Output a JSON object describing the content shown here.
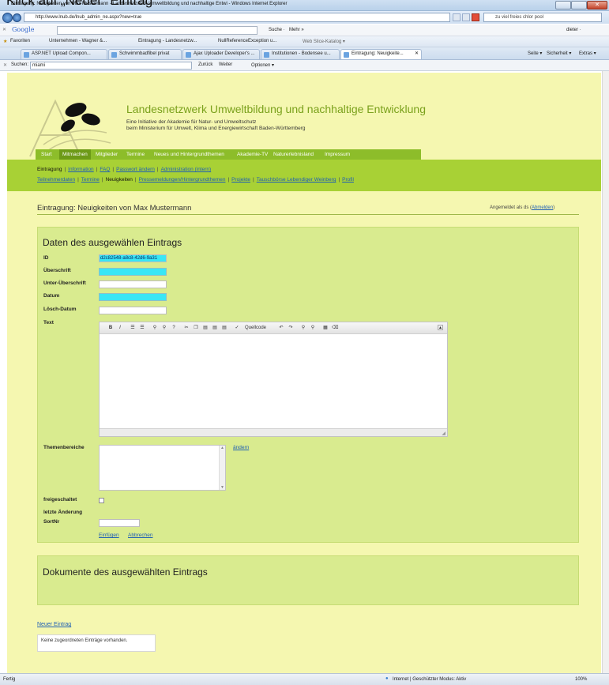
{
  "caption": "Klick auf „Neuer“ Eintrag",
  "window": {
    "title": "Eintragung: Neuigkeiten von Max Mustermann - Landesnetzwerk Umweltbildung und nachhaltige Entwi - Windows Internet Explorer",
    "close_glyph": "✕"
  },
  "address": {
    "url": "http://www.lnub.de/lnub_admin_ne.aspx?new=true",
    "search_placeholder": "zu viel freies chlor pool"
  },
  "google_bar": {
    "logo": "Google",
    "search_label": "Suche ·",
    "more_label": "Mehr »",
    "user": "dieter ·"
  },
  "favorites": {
    "label": "Favoriten",
    "items": [
      "Unternehmen - Wagner &...",
      "Eintragung - Landesnetzw...",
      "NullReferenceException u...",
      "Web Slice-Katalog ▾"
    ]
  },
  "tabs": [
    "ASP.NET Upload Compon...",
    "Schwimmbadfibel privat",
    "Ajax Uploader Developer's ...",
    "Institutionen - Bodensee u...",
    "Eintragung: Neuigkeite..."
  ],
  "tab_close_glyph": "✕",
  "command_bar": {
    "page": "Seite ▾",
    "security": "Sicherheit ▾",
    "extras": "Extras ▾"
  },
  "findbar": {
    "close": "✕",
    "label": "Suchen:",
    "value": "miami",
    "back": "Zurück",
    "forward": "Weiter",
    "options": "Optionen ▾"
  },
  "site": {
    "title": "Landesnetzwerk Umweltbildung und nachhaltige Entwicklung",
    "subtitle1": "Eine Initiative der Akademie für Natur- und Umweltschutz",
    "subtitle2": "beim Ministerium für Umwelt, Klima und Energiewirtschaft Baden-Württemberg",
    "nav": [
      "Start",
      "Mitmachen",
      "Mitglieder",
      "Termine",
      "Neues und Hintergrundthemen",
      "Akademie-TV",
      "Naturerlebnisland",
      "Impressum"
    ],
    "sub1": [
      "Eintragung",
      "Information",
      "FAQ",
      "Passwort ändern",
      "Administration (intern)"
    ],
    "sub2": [
      "Teilnehmerdaten",
      "Termine",
      "Neuigkeiten",
      "Pressemeldungen/Hintergrundthemen",
      "Projekte",
      "Tauschbörse Lebendiger Weinberg",
      "Profil"
    ],
    "sep": "|"
  },
  "page": {
    "heading": "Eintragung: Neuigkeiten von Max Mustermann",
    "logged_in_prefix": "Angemeldet als ds (",
    "logout": "Abmelden",
    "logged_in_suffix": ")"
  },
  "form": {
    "title": "Daten des ausgewählen Eintrags",
    "id_label": "ID",
    "id_value": "d2c82548-a8c8-42d6-9a31",
    "headline_label": "Überschrift",
    "subheadline_label": "Unter-Überschrift",
    "date_label": "Datum",
    "delete_date_label": "Lösch-Datum",
    "text_label": "Text",
    "source_label": "Quellcode",
    "topics_label": "Themenbereiche",
    "change_link": "ändern",
    "released_label": "freigeschaltet",
    "last_change_label": "letzte Änderung",
    "sort_label": "SortNr",
    "insert": "Einfügen",
    "cancel": "Abbrechen"
  },
  "documents": {
    "title": "Dokumente des ausgewählten Eintrags"
  },
  "new_entry": "Neuer Eintrag",
  "no_entries": "Keine zugeordneten Einträge vorhanden.",
  "status": {
    "left": "Fertig",
    "zone": "Internet | Geschützter Modus: Aktiv",
    "zoom": "100%"
  }
}
